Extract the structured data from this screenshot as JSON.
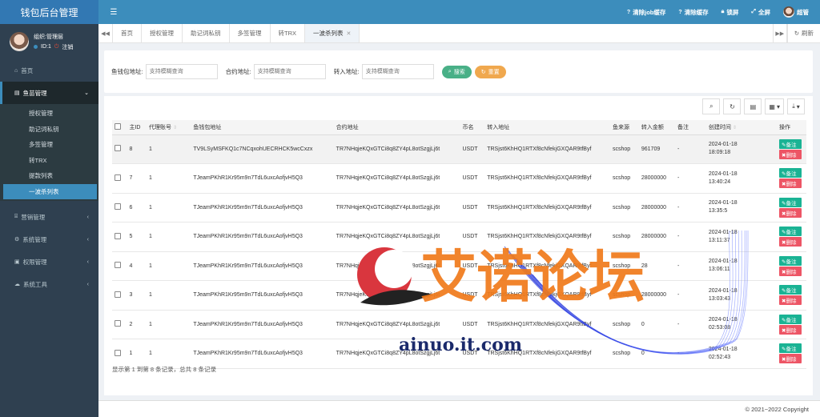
{
  "app": {
    "title": "钱包后台管理"
  },
  "user": {
    "name": "组织:管理层",
    "id": "ID:1",
    "logout": "注销"
  },
  "sidebar": {
    "items": [
      {
        "label": "首页",
        "icon": "home-icon"
      },
      {
        "label": "鱼苗管理",
        "icon": "dashboard-icon",
        "active": true
      },
      {
        "label": "营销管理",
        "icon": "bank-icon"
      },
      {
        "label": "系统管理",
        "icon": "gear-icon"
      },
      {
        "label": "权限管理",
        "icon": "window-icon"
      },
      {
        "label": "系统工具",
        "icon": "cloud-icon"
      }
    ],
    "submenu": [
      "授权管理",
      "助记词私钥",
      "多签管理",
      "转TRX",
      "提款列表",
      "一波杀列表"
    ]
  },
  "header": {
    "clear_job": "清除job缓存",
    "clear_cache": "清除缓存",
    "lock": "锁屏",
    "fullscreen": "全屏",
    "username": "超管"
  },
  "tabs": [
    "首页",
    "授权管理",
    "助记词私钥",
    "多签管理",
    "转TRX",
    "一波杀列表"
  ],
  "tabs_refresh": "刷新",
  "search": {
    "fields": [
      {
        "label": "鱼钱包地址:",
        "placeholder": "支持模糊查询"
      },
      {
        "label": "合约地址:",
        "placeholder": "支持模糊查询"
      },
      {
        "label": "转入地址:",
        "placeholder": "支持模糊查询"
      }
    ],
    "search_btn": "搜索",
    "reset_btn": "重置"
  },
  "table": {
    "columns": [
      "主ID",
      "代理账号",
      "鱼钱包地址",
      "合约地址",
      "币名",
      "转入地址",
      "鱼来源",
      "转入金额",
      "备注",
      "创建时间",
      "操作"
    ],
    "rows": [
      {
        "id": "8",
        "agent": "1",
        "wallet": "TV9LSyMSFKQ1c7NCqxohUECRHCK5wcCxzx",
        "contract": "TR7NHqjeKQxGTCi8q8ZY4pL8otSzgjLj6t",
        "coin": "USDT",
        "to": "TRSjst6KhHQ1RTXf8cNfekjGXQAR9tfByf",
        "source": "scshop",
        "amount": "961709",
        "note": "-",
        "date": "2024-01-18",
        "time": "18:09:18"
      },
      {
        "id": "7",
        "agent": "1",
        "wallet": "TJeamPKhR1Kr95m9n7TdL6uxcAofjvH5Q3",
        "contract": "TR7NHqjeKQxGTCi8q8ZY4pL8otSzgjLj6t",
        "coin": "USDT",
        "to": "TRSjst6KhHQ1RTXf8cNfekjGXQAR9tfByf",
        "source": "scshop",
        "amount": "28000000",
        "note": "-",
        "date": "2024-01-18",
        "time": "13:40:24"
      },
      {
        "id": "6",
        "agent": "1",
        "wallet": "TJeamPKhR1Kr95m9n7TdL6uxcAofjvH5Q3",
        "contract": "TR7NHqjeKQxGTCi8q8ZY4pL8otSzgjLj6t",
        "coin": "USDT",
        "to": "TRSjst6KhHQ1RTXf8cNfekjGXQAR9tfByf",
        "source": "scshop",
        "amount": "28000000",
        "note": "-",
        "date": "2024-01-18",
        "time": "13:35:5"
      },
      {
        "id": "5",
        "agent": "1",
        "wallet": "TJeamPKhR1Kr95m9n7TdL6uxcAofjvH5Q3",
        "contract": "TR7NHqjeKQxGTCi8q8ZY4pL8otSzgjLj6t",
        "coin": "USDT",
        "to": "TRSjst6KhHQ1RTXf8cNfekjGXQAR9tfByf",
        "source": "scshop",
        "amount": "28000000",
        "note": "-",
        "date": "2024-01-18",
        "time": "13:11:37"
      },
      {
        "id": "4",
        "agent": "1",
        "wallet": "TJeamPKhR1Kr95m9n7TdL6uxcAofjvH5Q3",
        "contract": "TR7NHqjeKQxGTCi8q8ZY4pL8otSzgjLj6t",
        "coin": "USDT",
        "to": "TRSjst6KhHQ1RTXf8cNfekjGXQAR9tfByf",
        "source": "scshop",
        "amount": "28",
        "note": "-",
        "date": "2024-01-18",
        "time": "13:06:11"
      },
      {
        "id": "3",
        "agent": "1",
        "wallet": "TJeamPKhR1Kr95m9n7TdL6uxcAofjvH5Q3",
        "contract": "TR7NHqjeKQxGTCi8q8ZY4pL8otSzgjLj6t",
        "coin": "USDT",
        "to": "TRSjst6KhHQ1RTXf8cNfekjGXQAR9tfByf",
        "source": "scshop",
        "amount": "28000000",
        "note": "-",
        "date": "2024-01-18",
        "time": "13:03:43"
      },
      {
        "id": "2",
        "agent": "1",
        "wallet": "TJeamPKhR1Kr95m9n7TdL6uxcAofjvH5Q3",
        "contract": "TR7NHqjeKQxGTCi8q8ZY4pL8otSzgjLj6t",
        "coin": "USDT",
        "to": "TRSjst6KhHQ1RTXf8cNfekjGXQAR9tfByf",
        "source": "scshop",
        "amount": "0",
        "note": "-",
        "date": "2024-01-18",
        "time": "02:53:08"
      },
      {
        "id": "1",
        "agent": "1",
        "wallet": "TJeamPKhR1Kr95m9n7TdL6uxcAofjvH5Q3",
        "contract": "TR7NHqjeKQxGTCi8q8ZY4pL8otSzgjLj6t",
        "coin": "USDT",
        "to": "TRSjst6KhHQ1RTXf8cNfekjGXQAR9tfByf",
        "source": "scshop",
        "amount": "0",
        "note": "-",
        "date": "2024-01-18",
        "time": "02:52:43"
      }
    ],
    "op_note": "备注",
    "op_delete": "删除",
    "pager": "显示第 1 到第 8 条记录，总共 8 条记录"
  },
  "footer": "© 2021~2022 Copyright",
  "watermark": {
    "text": "艾诺论坛",
    "url": "ainuo.it.com"
  },
  "colors": {
    "header": "#3c8dbc",
    "sidebar": "#2f4050",
    "note": "#1ab394",
    "delete": "#ed5565"
  }
}
